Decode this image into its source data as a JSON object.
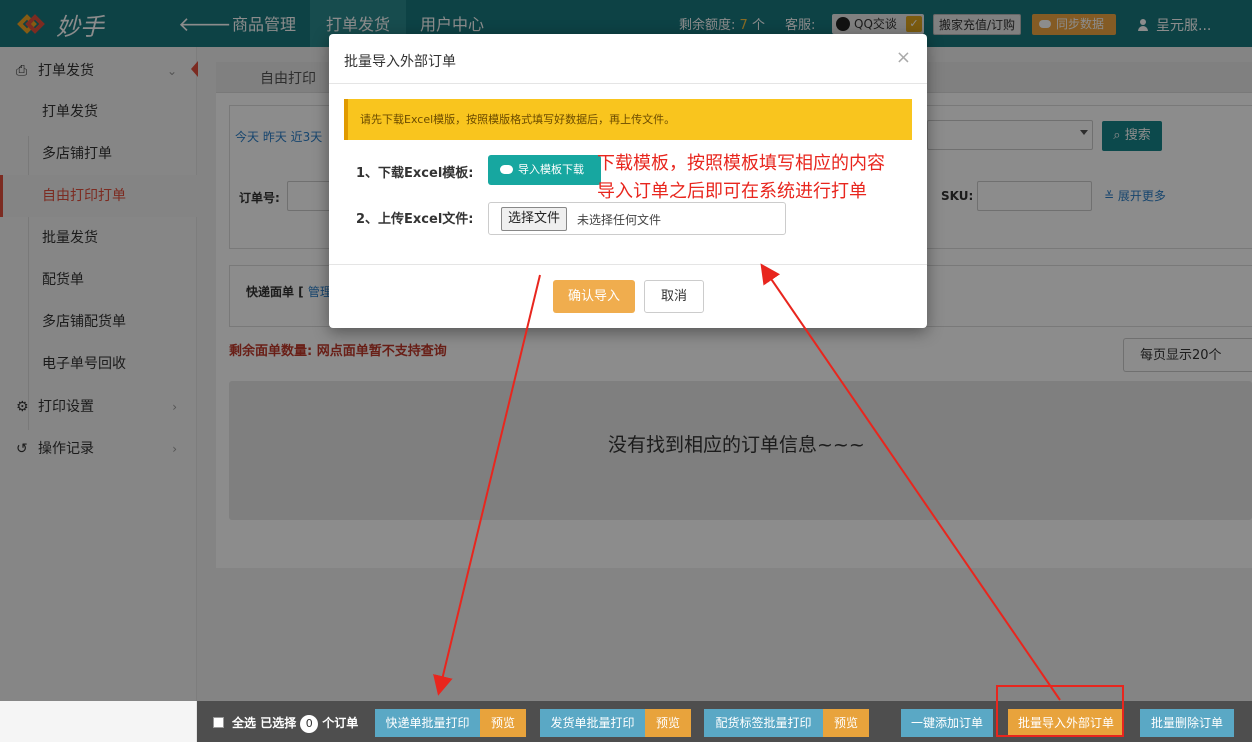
{
  "app": {
    "logo_text": "妙手"
  },
  "topnav": {
    "items": [
      {
        "label": "商品管理"
      },
      {
        "label": "打单发货"
      },
      {
        "label": "用户中心"
      }
    ],
    "quota_label": "剩余额度:",
    "quota_value": "7",
    "quota_unit": "个",
    "service_label": "客服:",
    "qq_label": "QQ交谈",
    "recharge_label": "搬家充值/订购",
    "sync_label": "同步数据",
    "user_name": "呈元服..."
  },
  "sidebar": {
    "groups": [
      {
        "label": "打单发货",
        "icon": "printer-icon"
      },
      {
        "label": "打印设置",
        "icon": "gear-icon"
      },
      {
        "label": "操作记录",
        "icon": "history-icon"
      }
    ],
    "sub_items": [
      {
        "label": "打单发货"
      },
      {
        "label": "多店铺打单"
      },
      {
        "label": "自由打印打单"
      },
      {
        "label": "批量发货"
      },
      {
        "label": "配货单"
      },
      {
        "label": "多店铺配货单"
      },
      {
        "label": "电子单号回收"
      }
    ]
  },
  "main": {
    "tab_label": "自由打印",
    "date_links": "今天  昨天  近3天  ",
    "order_no_label": "订单号:",
    "sku_label": "SKU:",
    "search_label": "搜索",
    "expand_label": "展开更多",
    "express_label": "快递面单 [",
    "express_link": "管理",
    "remaining_text": "剩余面单数量: 网点面单暂不支持查询",
    "per_page": "每页显示20个",
    "empty_text": "没有找到相应的订单信息~~~"
  },
  "bottombar": {
    "select_all": "全选",
    "selected_prefix": "已选择",
    "selected_count": "0",
    "selected_suffix": "个订单",
    "buttons": [
      {
        "label": "快递单批量打印",
        "preview": "预览"
      },
      {
        "label": "发货单批量打印",
        "preview": "预览"
      },
      {
        "label": "配货标签批量打印",
        "preview": "预览"
      },
      {
        "label": "一键添加订单"
      },
      {
        "label": "批量导入外部订单"
      },
      {
        "label": "批量删除订单"
      }
    ]
  },
  "modal": {
    "title": "批量导入外部订单",
    "close_symbol": "×",
    "alert": "请先下载Excel模版，按照模版格式填写好数据后，再上传文件。",
    "step1_label": "1、下载Excel模板:",
    "download_button": "导入模板下载",
    "step2_label": "2、上传Excel文件:",
    "file_button": "选择文件",
    "file_status": "未选择任何文件",
    "confirm_button": "确认导入",
    "cancel_button": "取消"
  },
  "annotations": {
    "line1": "下载模板，按照模板填写相应的内容",
    "line2": "导入订单之后即可在系统进行打单",
    "color": "#e8261e"
  }
}
